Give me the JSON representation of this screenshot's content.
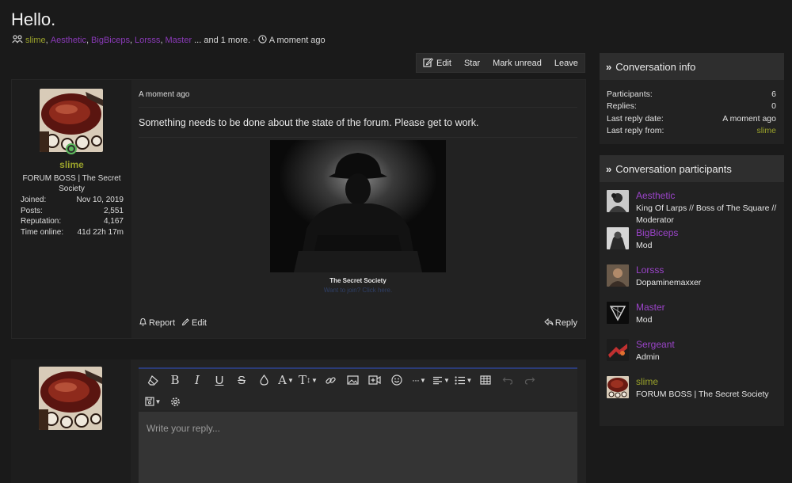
{
  "page": {
    "title": "Hello.",
    "participants_preview": [
      {
        "name": "slime",
        "color": "#9aa22b"
      },
      {
        "name": "Aesthetic",
        "color": "#8a3ab8"
      },
      {
        "name": "BigBiceps",
        "color": "#8a3ab8"
      },
      {
        "name": "Lorsss",
        "color": "#8a3ab8"
      },
      {
        "name": "Master",
        "color": "#8a3ab8"
      }
    ],
    "more_text": "... and 1 more.",
    "separator": "·",
    "time_text": "A moment ago"
  },
  "actions": {
    "edit": "Edit",
    "star": "Star",
    "mark_unread": "Mark unread",
    "leave": "Leave"
  },
  "message": {
    "author": {
      "name": "slime",
      "title": "FORUM BOSS | The Secret Society",
      "stats": [
        {
          "label": "Joined:",
          "value": "Nov 10, 2019"
        },
        {
          "label": "Posts:",
          "value": "2,551"
        },
        {
          "label": "Reputation:",
          "value": "4,167"
        },
        {
          "label": "Time online:",
          "value": "41d 22h 17m"
        }
      ]
    },
    "time": "A moment ago",
    "body": "Something needs to be done about the state of the forum. Please get to work.",
    "image_caption": "The Secret Society",
    "image_link": "Want to join? Click here.",
    "report": "Report",
    "edit": "Edit",
    "reply": "Reply"
  },
  "editor": {
    "placeholder": "Write your reply..."
  },
  "sidebar": {
    "info": {
      "title": "Conversation info",
      "rows": [
        {
          "label": "Participants:",
          "value": "6"
        },
        {
          "label": "Replies:",
          "value": "0"
        },
        {
          "label": "Last reply date:",
          "value": "A moment ago"
        },
        {
          "label": "Last reply from:",
          "value": "slime"
        }
      ]
    },
    "participants": {
      "title": "Conversation participants",
      "items": [
        {
          "name": "Aesthetic",
          "title": "King Of Larps // Boss of The Square // Moderator",
          "color": "#8a3ab8"
        },
        {
          "name": "BigBiceps",
          "title": "Mod",
          "color": "#8a3ab8"
        },
        {
          "name": "Lorsss",
          "title": "Dopaminemaxxer",
          "color": "#8a3ab8"
        },
        {
          "name": "Master",
          "title": "Mod",
          "color": "#8a3ab8"
        },
        {
          "name": "Sergeant",
          "title": "Admin",
          "color": "#8a3ab8"
        },
        {
          "name": "slime",
          "title": "FORUM BOSS | The Secret Society",
          "color": "#9aa22b"
        }
      ]
    }
  }
}
